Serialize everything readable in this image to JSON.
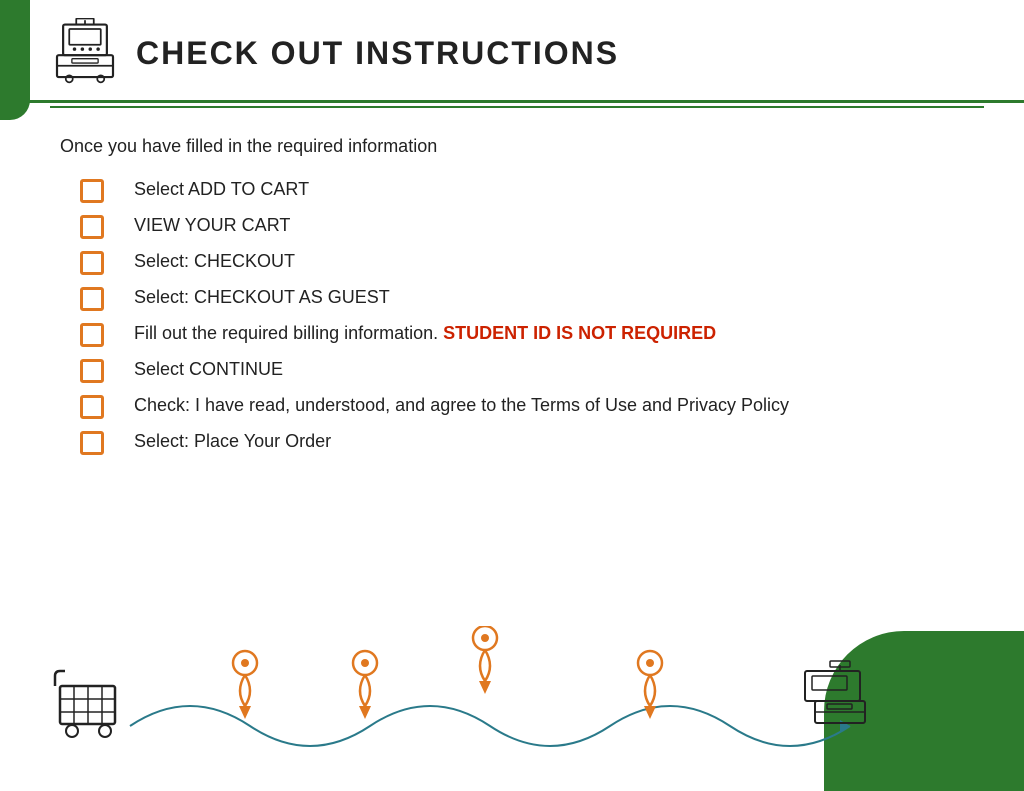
{
  "header": {
    "title": "CHECK OUT INSTRUCTIONS",
    "icon_alt": "cash-register-icon"
  },
  "intro": {
    "text": "Once you have filled in the required information"
  },
  "checklist": {
    "items": [
      {
        "id": 1,
        "text": "Select ADD TO CART",
        "has_red": false,
        "red_text": ""
      },
      {
        "id": 2,
        "text": "VIEW YOUR CART",
        "has_red": false,
        "red_text": ""
      },
      {
        "id": 3,
        "text": "Select: CHECKOUT",
        "has_red": false,
        "red_text": ""
      },
      {
        "id": 4,
        "text": "Select: CHECKOUT AS GUEST",
        "has_red": false,
        "red_text": ""
      },
      {
        "id": 5,
        "text": "Fill out the required billing information.",
        "has_red": true,
        "red_text": " STUDENT ID IS NOT REQUIRED"
      },
      {
        "id": 6,
        "text": "Select CONTINUE",
        "has_red": false,
        "red_text": ""
      },
      {
        "id": 7,
        "text": "Check: I have read, understood, and agree to the Terms of Use and Privacy Policy",
        "has_red": false,
        "red_text": ""
      },
      {
        "id": 8,
        "text": "Select: Place Your Order",
        "has_red": false,
        "red_text": ""
      }
    ]
  },
  "colors": {
    "green": "#2d7a2d",
    "orange": "#e07820",
    "red": "#cc2200"
  }
}
